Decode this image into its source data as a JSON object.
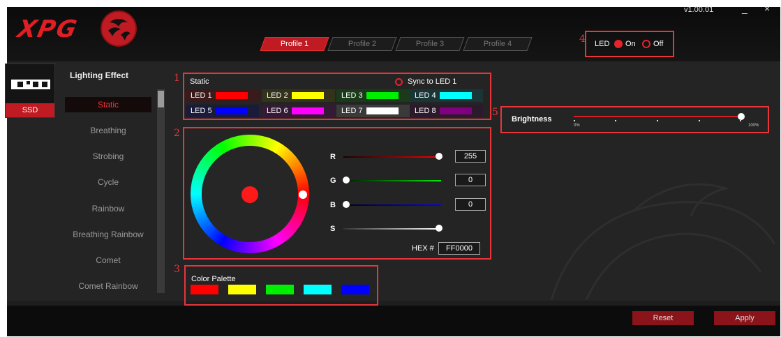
{
  "app": {
    "logo_text": "XPG",
    "version": "v1.00.01",
    "minimize_glyph": "_",
    "close_glyph": "×"
  },
  "profiles": [
    {
      "label": "Profile 1",
      "active": true
    },
    {
      "label": "Profile 2",
      "active": false
    },
    {
      "label": "Profile 3",
      "active": false
    },
    {
      "label": "Profile 4",
      "active": false
    }
  ],
  "led_switch": {
    "label": "LED",
    "on_label": "On",
    "off_label": "Off",
    "state": "On"
  },
  "device": {
    "label": "SSD",
    "icon": "ssd-icon"
  },
  "effects": {
    "title": "Lighting Effect",
    "items": [
      "Static",
      "Breathing",
      "Strobing",
      "Cycle",
      "Rainbow",
      "Breathing Rainbow",
      "Comet",
      "Comet Rainbow"
    ],
    "selected": "Static"
  },
  "annotations": [
    "1",
    "2",
    "3",
    "4",
    "5"
  ],
  "led_panel": {
    "mode_label": "Static",
    "sync_label": "Sync to LED 1",
    "leds": [
      {
        "name": "LED 1",
        "color": "#ff0000",
        "bg": "#3a1a1a"
      },
      {
        "name": "LED 2",
        "color": "#ffff00",
        "bg": "#33321a"
      },
      {
        "name": "LED 3",
        "color": "#00ee00",
        "bg": "#1a3a1a"
      },
      {
        "name": "LED 4",
        "color": "#00ffff",
        "bg": "#1a3535"
      },
      {
        "name": "LED 5",
        "color": "#0000ff",
        "bg": "#1a1a3a"
      },
      {
        "name": "LED 6",
        "color": "#ff00ff",
        "bg": "#341a34"
      },
      {
        "name": "LED 7",
        "color": "#ffffff",
        "bg": "#3a3a3a"
      },
      {
        "name": "LED 8",
        "color": "#800080",
        "bg": "#2b1a2b"
      }
    ]
  },
  "color_picker": {
    "channels": [
      {
        "label": "R",
        "value": "255",
        "fraction": 1.0
      },
      {
        "label": "G",
        "value": "0",
        "fraction": 0.0
      },
      {
        "label": "B",
        "value": "0",
        "fraction": 0.0
      }
    ],
    "saturation": {
      "label": "S",
      "fraction": 1.0
    },
    "hex_label": "HEX #",
    "hex_value": "FF0000",
    "current_color": "#ff0000"
  },
  "palette": {
    "title": "Color Palette",
    "colors": [
      "#ff0000",
      "#ffff00",
      "#00ee00",
      "#00ffff",
      "#0000ff"
    ]
  },
  "brightness": {
    "label": "Brightness",
    "min_label": "0%",
    "max_label": "100%",
    "level_percent": 100
  },
  "footer": {
    "reset_label": "Reset",
    "apply_label": "Apply"
  },
  "colors": {
    "accent": "#e8353a",
    "brand_red": "#c01b22"
  }
}
